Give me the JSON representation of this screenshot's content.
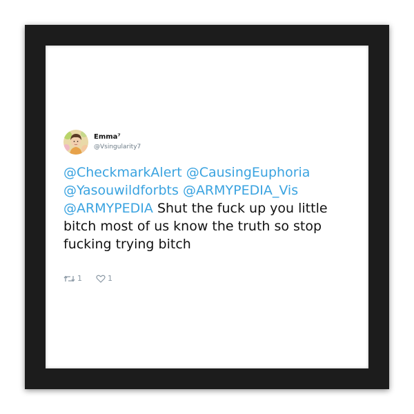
{
  "tweet": {
    "display_name": "Emma⁷",
    "handle": "@Vsingularity7",
    "mentions": [
      "@CheckmarkAlert",
      "@CausingEuphoria",
      "@Yasouwildforbts",
      "@ARMYPEDIA_Vis",
      "@ARMYPEDIA"
    ],
    "text": "Shut the fuck up you little bitch most of us know the truth so stop fucking trying bitch",
    "retweet_count": "1",
    "like_count": "1"
  },
  "colors": {
    "mention": "#3aa3e0",
    "frame": "#1c1c1c",
    "text": "#111111",
    "muted": "#8a98a4"
  },
  "icons": {
    "retweet": "retweet-icon",
    "like": "heart-icon",
    "avatar": "avatar"
  }
}
